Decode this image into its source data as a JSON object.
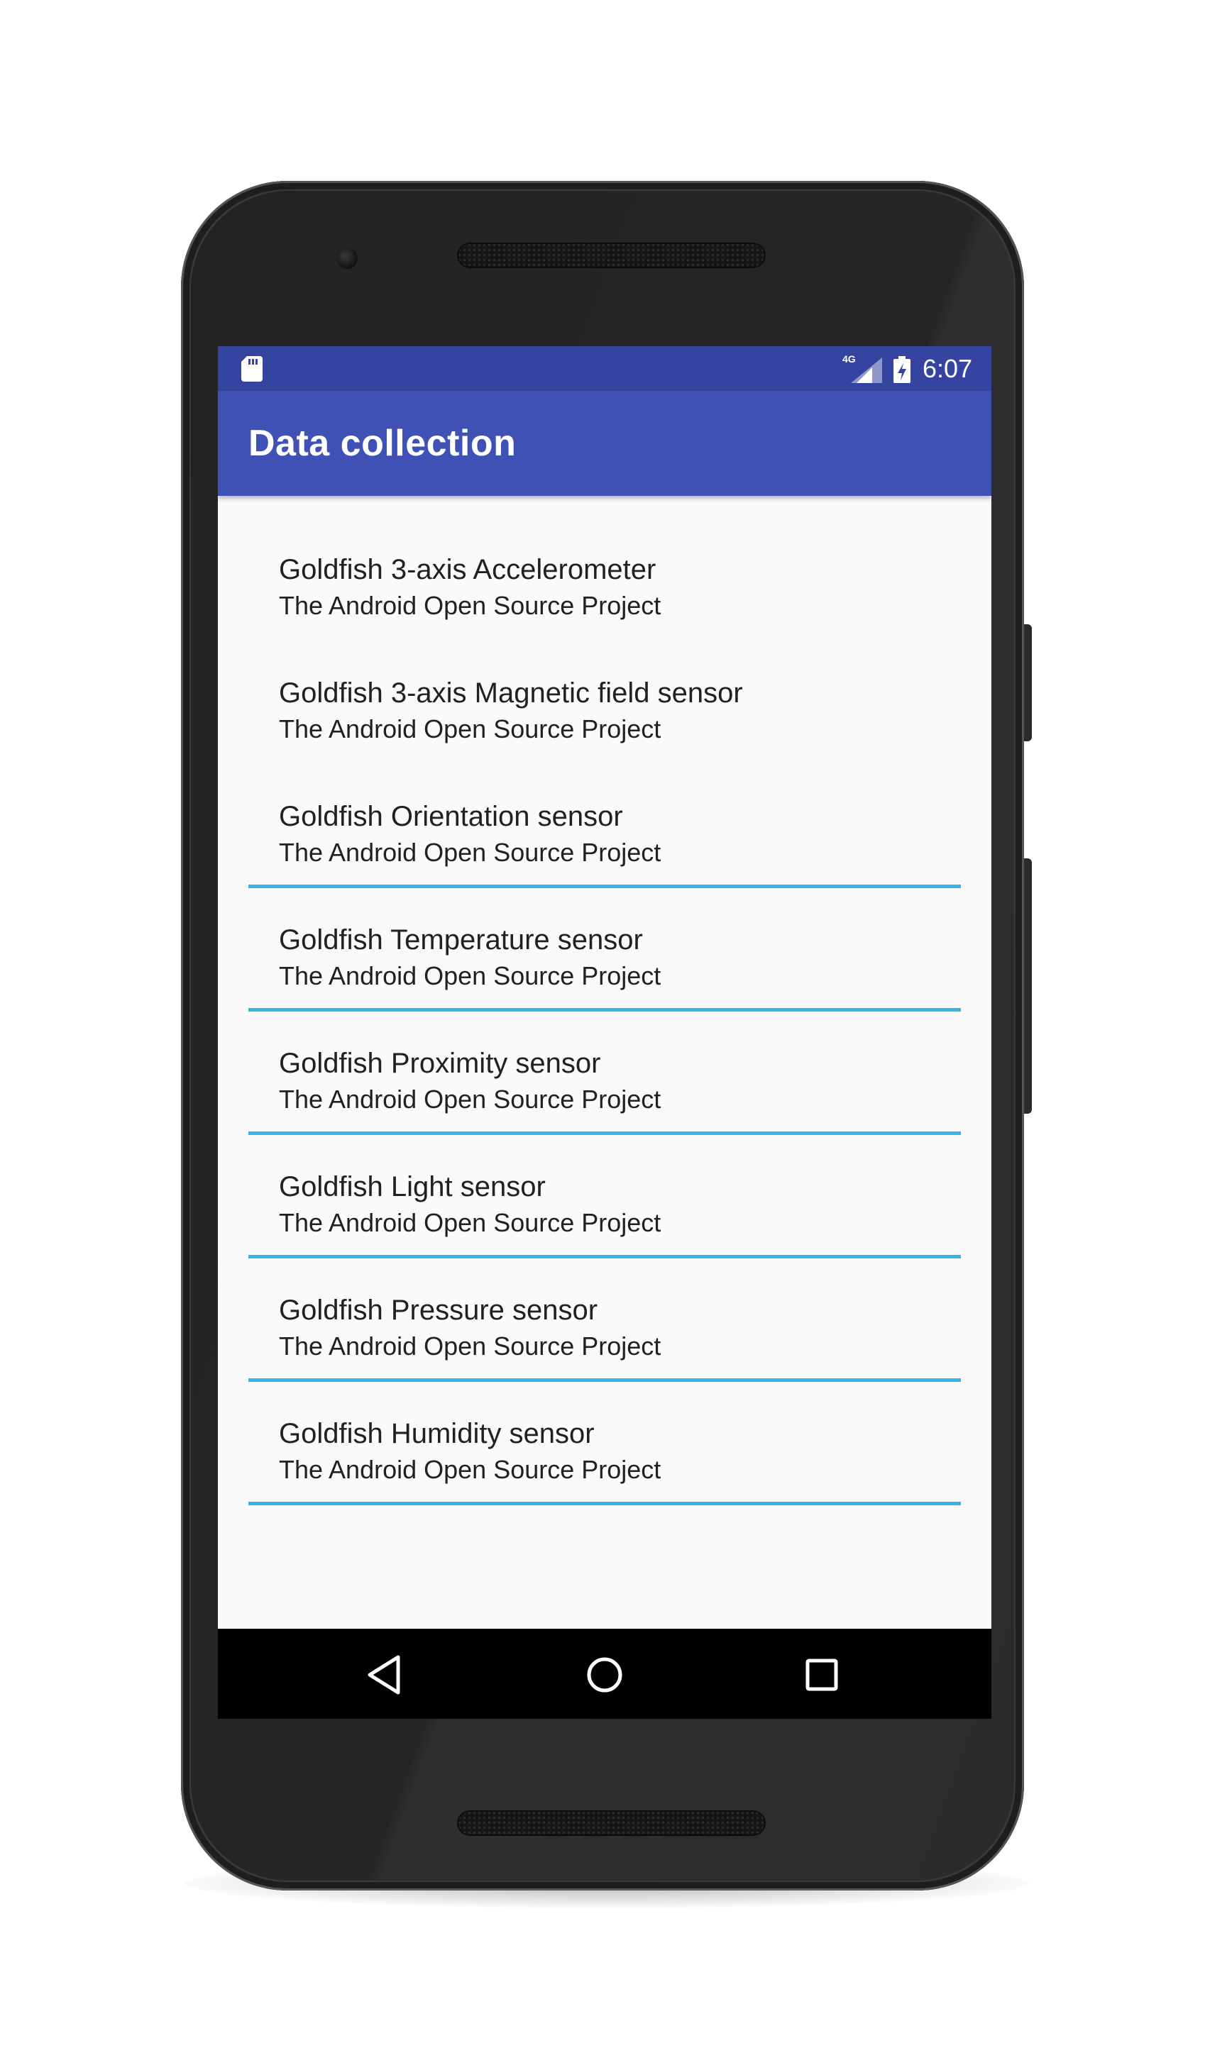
{
  "status_bar": {
    "network": "4G",
    "time": "6:07",
    "left_icon": "sd-card-icon",
    "signal_icon": "cell-signal-icon",
    "battery_icon": "battery-charging-icon"
  },
  "app_bar": {
    "title": "Data collection"
  },
  "sensors": [
    {
      "name": "Goldfish 3-axis Accelerometer",
      "vendor": "The Android Open Source Project"
    },
    {
      "name": "Goldfish 3-axis Magnetic field sensor",
      "vendor": "The Android Open Source Project"
    },
    {
      "name": "Goldfish Orientation sensor",
      "vendor": "The Android Open Source Project"
    },
    {
      "name": "Goldfish Temperature sensor",
      "vendor": "The Android Open Source Project"
    },
    {
      "name": "Goldfish Proximity sensor",
      "vendor": "The Android Open Source Project"
    },
    {
      "name": "Goldfish Light sensor",
      "vendor": "The Android Open Source Project"
    },
    {
      "name": "Goldfish Pressure sensor",
      "vendor": "The Android Open Source Project"
    },
    {
      "name": "Goldfish Humidity sensor",
      "vendor": "The Android Open Source Project"
    }
  ],
  "nav_bar": {
    "back_icon": "back-triangle-icon",
    "home_icon": "home-circle-icon",
    "recents_icon": "recents-square-icon"
  },
  "colors": {
    "status_bar": "#3444a0",
    "app_bar": "#3f51b5",
    "divider": "#33b5e5",
    "list_background": "#fafafa",
    "nav_bar": "#000000"
  }
}
